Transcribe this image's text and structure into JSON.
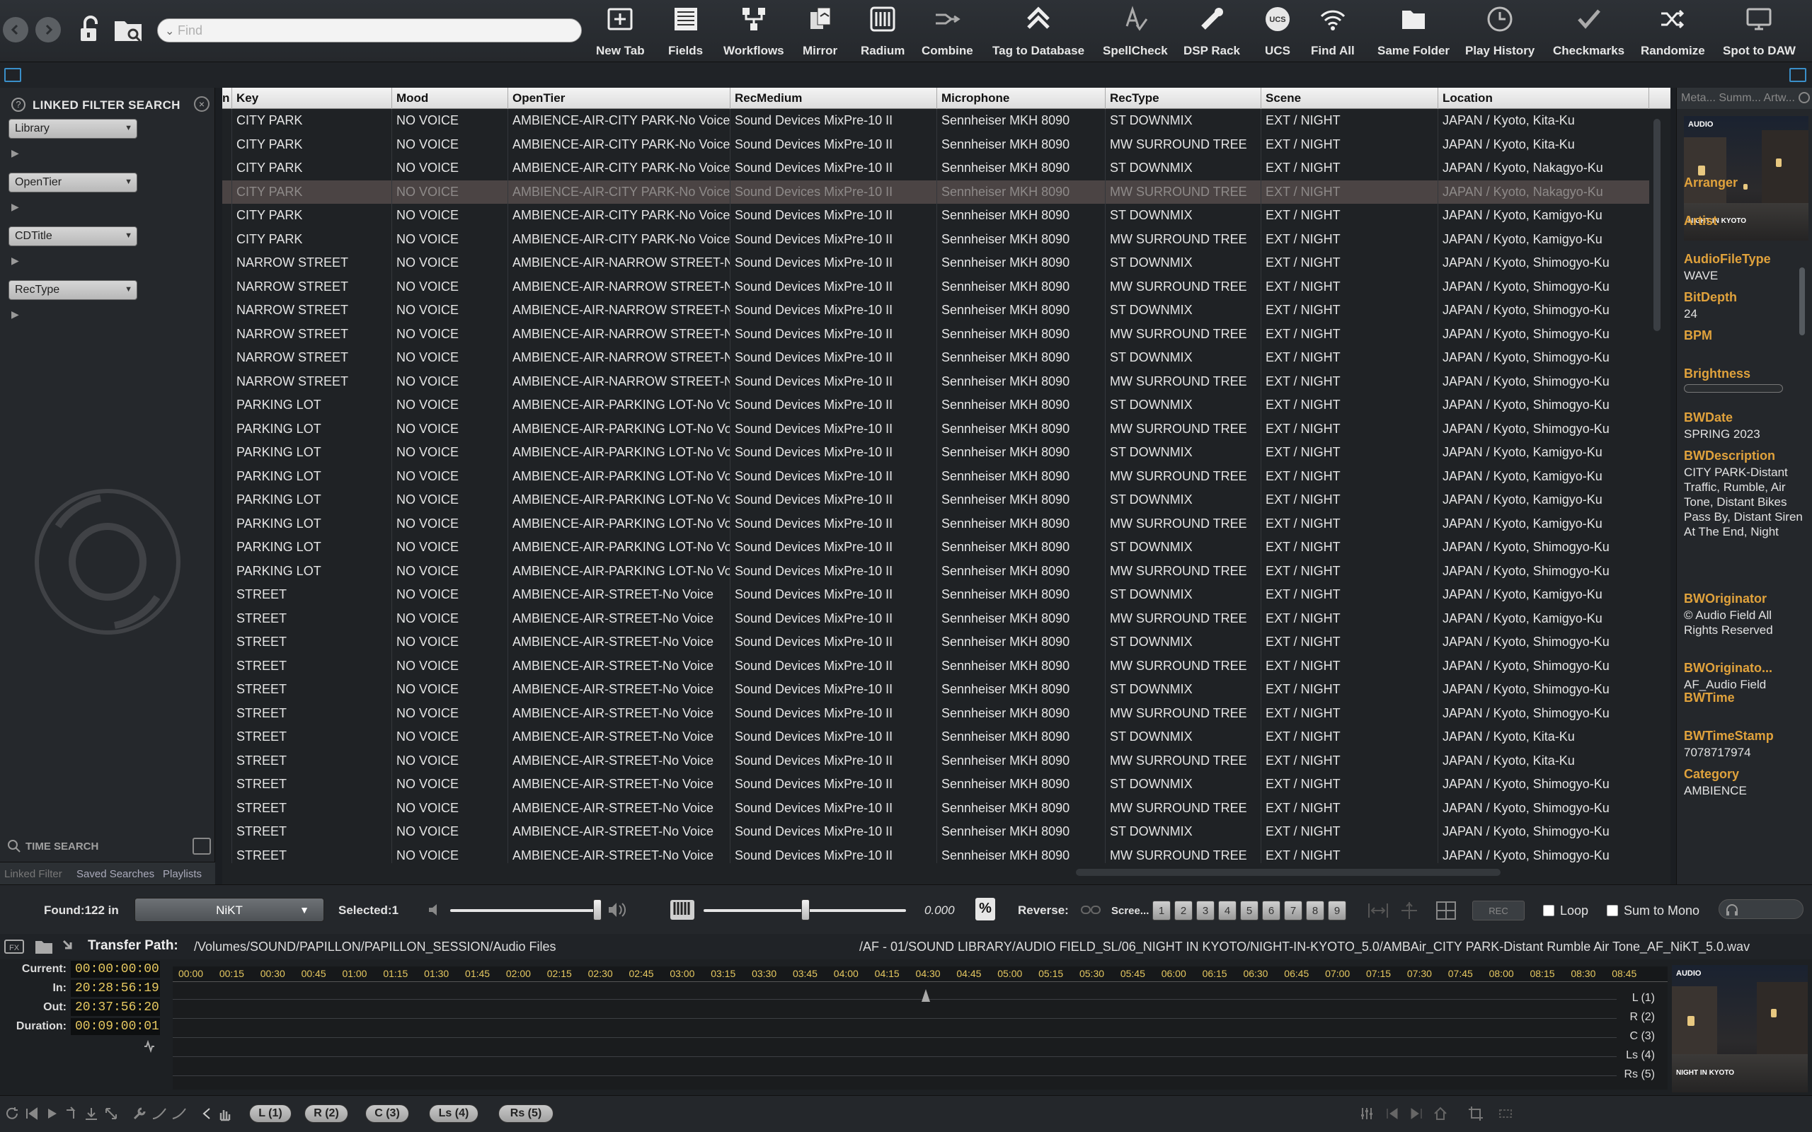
{
  "toolbar": {
    "find_placeholder": "Find",
    "tools": [
      {
        "label": "New Tab",
        "icon": "new-tab-icon"
      },
      {
        "label": "Fields",
        "icon": "fields-icon"
      },
      {
        "label": "Workflows",
        "icon": "workflows-icon"
      },
      {
        "label": "Mirror",
        "icon": "mirror-icon"
      },
      {
        "label": "Radium",
        "icon": "radium-icon"
      },
      {
        "label": "Combine",
        "icon": "combine-icon"
      },
      {
        "label": "Tag to Database",
        "icon": "tag-to-database-icon"
      },
      {
        "label": "SpellCheck",
        "icon": "spellcheck-icon"
      },
      {
        "label": "DSP Rack",
        "icon": "dsp-rack-icon"
      },
      {
        "label": "UCS",
        "icon": "ucs-icon"
      },
      {
        "label": "Find All",
        "icon": "find-all-icon"
      },
      {
        "label": "Same Folder",
        "icon": "same-folder-icon"
      },
      {
        "label": "Play History",
        "icon": "play-history-icon"
      },
      {
        "label": "Checkmarks",
        "icon": "checkmarks-icon"
      },
      {
        "label": "Randomize",
        "icon": "randomize-icon"
      },
      {
        "label": "Spot to DAW",
        "icon": "spot-to-daw-icon"
      }
    ]
  },
  "left_panel": {
    "title": "LINKED FILTER SEARCH",
    "filters": [
      "Library",
      "OpenTier",
      "CDTitle",
      "RecType"
    ],
    "time_search": "TIME SEARCH",
    "tabs": [
      "Linked Filter",
      "Saved Searches",
      "Playlists"
    ]
  },
  "table": {
    "columns": [
      "n",
      "Key",
      "Mood",
      "OpenTier",
      "RecMedium",
      "Microphone",
      "RecType",
      "Scene",
      "Location"
    ],
    "selected_row": 3,
    "rows": [
      [
        "CITY PARK",
        "NO VOICE",
        "AMBIENCE-AIR-CITY PARK-No Voice",
        "Sound Devices MixPre-10 II",
        "Sennheiser MKH 8090",
        "ST DOWNMIX",
        "EXT / NIGHT",
        "JAPAN / Kyoto, Kita-Ku"
      ],
      [
        "CITY PARK",
        "NO VOICE",
        "AMBIENCE-AIR-CITY PARK-No Voice",
        "Sound Devices MixPre-10 II",
        "Sennheiser MKH 8090",
        "MW SURROUND TREE",
        "EXT / NIGHT",
        "JAPAN / Kyoto, Kita-Ku"
      ],
      [
        "CITY PARK",
        "NO VOICE",
        "AMBIENCE-AIR-CITY PARK-No Voice",
        "Sound Devices MixPre-10 II",
        "Sennheiser MKH 8090",
        "ST DOWNMIX",
        "EXT / NIGHT",
        "JAPAN / Kyoto, Nakagyo-Ku"
      ],
      [
        "CITY PARK",
        "NO VOICE",
        "AMBIENCE-AIR-CITY PARK-No Voice",
        "Sound Devices MixPre-10 II",
        "Sennheiser MKH 8090",
        "MW SURROUND TREE",
        "EXT / NIGHT",
        "JAPAN / Kyoto, Nakagyo-Ku"
      ],
      [
        "CITY PARK",
        "NO VOICE",
        "AMBIENCE-AIR-CITY PARK-No Voice",
        "Sound Devices MixPre-10 II",
        "Sennheiser MKH 8090",
        "ST DOWNMIX",
        "EXT / NIGHT",
        "JAPAN / Kyoto, Kamigyo-Ku"
      ],
      [
        "CITY PARK",
        "NO VOICE",
        "AMBIENCE-AIR-CITY PARK-No Voice",
        "Sound Devices MixPre-10 II",
        "Sennheiser MKH 8090",
        "MW SURROUND TREE",
        "EXT / NIGHT",
        "JAPAN / Kyoto, Kamigyo-Ku"
      ],
      [
        "NARROW STREET",
        "NO VOICE",
        "AMBIENCE-AIR-NARROW STREET-No Voice",
        "Sound Devices MixPre-10 II",
        "Sennheiser MKH 8090",
        "ST DOWNMIX",
        "EXT / NIGHT",
        "JAPAN / Kyoto, Shimogyo-Ku"
      ],
      [
        "NARROW STREET",
        "NO VOICE",
        "AMBIENCE-AIR-NARROW STREET-No Voice",
        "Sound Devices MixPre-10 II",
        "Sennheiser MKH 8090",
        "MW SURROUND TREE",
        "EXT / NIGHT",
        "JAPAN / Kyoto, Shimogyo-Ku"
      ],
      [
        "NARROW STREET",
        "NO VOICE",
        "AMBIENCE-AIR-NARROW STREET-No Voice",
        "Sound Devices MixPre-10 II",
        "Sennheiser MKH 8090",
        "ST DOWNMIX",
        "EXT / NIGHT",
        "JAPAN / Kyoto, Shimogyo-Ku"
      ],
      [
        "NARROW STREET",
        "NO VOICE",
        "AMBIENCE-AIR-NARROW STREET-No Voice",
        "Sound Devices MixPre-10 II",
        "Sennheiser MKH 8090",
        "MW SURROUND TREE",
        "EXT / NIGHT",
        "JAPAN / Kyoto, Shimogyo-Ku"
      ],
      [
        "NARROW STREET",
        "NO VOICE",
        "AMBIENCE-AIR-NARROW STREET-No Voice",
        "Sound Devices MixPre-10 II",
        "Sennheiser MKH 8090",
        "ST DOWNMIX",
        "EXT / NIGHT",
        "JAPAN / Kyoto, Shimogyo-Ku"
      ],
      [
        "NARROW STREET",
        "NO VOICE",
        "AMBIENCE-AIR-NARROW STREET-No Voice",
        "Sound Devices MixPre-10 II",
        "Sennheiser MKH 8090",
        "MW SURROUND TREE",
        "EXT / NIGHT",
        "JAPAN / Kyoto, Shimogyo-Ku"
      ],
      [
        "PARKING LOT",
        "NO VOICE",
        "AMBIENCE-AIR-PARKING LOT-No Voice",
        "Sound Devices MixPre-10 II",
        "Sennheiser MKH 8090",
        "ST DOWNMIX",
        "EXT / NIGHT",
        "JAPAN / Kyoto, Shimogyo-Ku"
      ],
      [
        "PARKING LOT",
        "NO VOICE",
        "AMBIENCE-AIR-PARKING LOT-No Voice",
        "Sound Devices MixPre-10 II",
        "Sennheiser MKH 8090",
        "MW SURROUND TREE",
        "EXT / NIGHT",
        "JAPAN / Kyoto, Shimogyo-Ku"
      ],
      [
        "PARKING LOT",
        "NO VOICE",
        "AMBIENCE-AIR-PARKING LOT-No Voice",
        "Sound Devices MixPre-10 II",
        "Sennheiser MKH 8090",
        "ST DOWNMIX",
        "EXT / NIGHT",
        "JAPAN / Kyoto, Kamigyo-Ku"
      ],
      [
        "PARKING LOT",
        "NO VOICE",
        "AMBIENCE-AIR-PARKING LOT-No Voice",
        "Sound Devices MixPre-10 II",
        "Sennheiser MKH 8090",
        "MW SURROUND TREE",
        "EXT / NIGHT",
        "JAPAN / Kyoto, Kamigyo-Ku"
      ],
      [
        "PARKING LOT",
        "NO VOICE",
        "AMBIENCE-AIR-PARKING LOT-No Voice",
        "Sound Devices MixPre-10 II",
        "Sennheiser MKH 8090",
        "ST DOWNMIX",
        "EXT / NIGHT",
        "JAPAN / Kyoto, Kamigyo-Ku"
      ],
      [
        "PARKING LOT",
        "NO VOICE",
        "AMBIENCE-AIR-PARKING LOT-No Voice",
        "Sound Devices MixPre-10 II",
        "Sennheiser MKH 8090",
        "MW SURROUND TREE",
        "EXT / NIGHT",
        "JAPAN / Kyoto, Kamigyo-Ku"
      ],
      [
        "PARKING LOT",
        "NO VOICE",
        "AMBIENCE-AIR-PARKING LOT-No Voice",
        "Sound Devices MixPre-10 II",
        "Sennheiser MKH 8090",
        "ST DOWNMIX",
        "EXT / NIGHT",
        "JAPAN / Kyoto, Shimogyo-Ku"
      ],
      [
        "PARKING LOT",
        "NO VOICE",
        "AMBIENCE-AIR-PARKING LOT-No Voice",
        "Sound Devices MixPre-10 II",
        "Sennheiser MKH 8090",
        "MW SURROUND TREE",
        "EXT / NIGHT",
        "JAPAN / Kyoto, Shimogyo-Ku"
      ],
      [
        "STREET",
        "NO VOICE",
        "AMBIENCE-AIR-STREET-No Voice",
        "Sound Devices MixPre-10 II",
        "Sennheiser MKH 8090",
        "ST DOWNMIX",
        "EXT / NIGHT",
        "JAPAN / Kyoto, Kamigyo-Ku"
      ],
      [
        "STREET",
        "NO VOICE",
        "AMBIENCE-AIR-STREET-No Voice",
        "Sound Devices MixPre-10 II",
        "Sennheiser MKH 8090",
        "MW SURROUND TREE",
        "EXT / NIGHT",
        "JAPAN / Kyoto, Kamigyo-Ku"
      ],
      [
        "STREET",
        "NO VOICE",
        "AMBIENCE-AIR-STREET-No Voice",
        "Sound Devices MixPre-10 II",
        "Sennheiser MKH 8090",
        "ST DOWNMIX",
        "EXT / NIGHT",
        "JAPAN / Kyoto, Shimogyo-Ku"
      ],
      [
        "STREET",
        "NO VOICE",
        "AMBIENCE-AIR-STREET-No Voice",
        "Sound Devices MixPre-10 II",
        "Sennheiser MKH 8090",
        "MW SURROUND TREE",
        "EXT / NIGHT",
        "JAPAN / Kyoto, Shimogyo-Ku"
      ],
      [
        "STREET",
        "NO VOICE",
        "AMBIENCE-AIR-STREET-No Voice",
        "Sound Devices MixPre-10 II",
        "Sennheiser MKH 8090",
        "ST DOWNMIX",
        "EXT / NIGHT",
        "JAPAN / Kyoto, Shimogyo-Ku"
      ],
      [
        "STREET",
        "NO VOICE",
        "AMBIENCE-AIR-STREET-No Voice",
        "Sound Devices MixPre-10 II",
        "Sennheiser MKH 8090",
        "MW SURROUND TREE",
        "EXT / NIGHT",
        "JAPAN / Kyoto, Shimogyo-Ku"
      ],
      [
        "STREET",
        "NO VOICE",
        "AMBIENCE-AIR-STREET-No Voice",
        "Sound Devices MixPre-10 II",
        "Sennheiser MKH 8090",
        "ST DOWNMIX",
        "EXT / NIGHT",
        "JAPAN / Kyoto, Kita-Ku"
      ],
      [
        "STREET",
        "NO VOICE",
        "AMBIENCE-AIR-STREET-No Voice",
        "Sound Devices MixPre-10 II",
        "Sennheiser MKH 8090",
        "MW SURROUND TREE",
        "EXT / NIGHT",
        "JAPAN / Kyoto, Kita-Ku"
      ],
      [
        "STREET",
        "NO VOICE",
        "AMBIENCE-AIR-STREET-No Voice",
        "Sound Devices MixPre-10 II",
        "Sennheiser MKH 8090",
        "ST DOWNMIX",
        "EXT / NIGHT",
        "JAPAN / Kyoto, Shimogyo-Ku"
      ],
      [
        "STREET",
        "NO VOICE",
        "AMBIENCE-AIR-STREET-No Voice",
        "Sound Devices MixPre-10 II",
        "Sennheiser MKH 8090",
        "MW SURROUND TREE",
        "EXT / NIGHT",
        "JAPAN / Kyoto, Shimogyo-Ku"
      ],
      [
        "STREET",
        "NO VOICE",
        "AMBIENCE-AIR-STREET-No Voice",
        "Sound Devices MixPre-10 II",
        "Sennheiser MKH 8090",
        "ST DOWNMIX",
        "EXT / NIGHT",
        "JAPAN / Kyoto, Shimogyo-Ku"
      ],
      [
        "STREET",
        "NO VOICE",
        "AMBIENCE-AIR-STREET-No Voice",
        "Sound Devices MixPre-10 II",
        "Sennheiser MKH 8090",
        "MW SURROUND TREE",
        "EXT / NIGHT",
        "JAPAN / Kyoto, Shimogyo-Ku"
      ]
    ]
  },
  "meta_panel": {
    "tabs": "Meta... Summ... Artw...",
    "artwork_logo": "AUDIO",
    "artwork_caption": "NIGHT IN KYOTO",
    "fields": [
      {
        "key": "Arranger",
        "value": ""
      },
      {
        "key": "Artist",
        "value": ""
      },
      {
        "key": "AudioFileType",
        "value": "WAVE"
      },
      {
        "key": "BitDepth",
        "value": "24"
      },
      {
        "key": "BPM",
        "value": ""
      },
      {
        "key": "Brightness",
        "value": ""
      },
      {
        "key": "BWDate",
        "value": "SPRING 2023"
      },
      {
        "key": "BWDescription",
        "value": "CITY PARK-Distant Traffic, Rumble, Air Tone, Distant Bikes Pass By, Distant Siren At The End, Night"
      },
      {
        "key": "BWOriginator",
        "value": "© Audio Field All Rights Reserved"
      },
      {
        "key": "BWOriginato...",
        "value": "AF_Audio Field"
      },
      {
        "key": "BWTime",
        "value": ""
      },
      {
        "key": "BWTimeStamp",
        "value": "7078717974"
      },
      {
        "key": "Category",
        "value": "AMBIENCE"
      }
    ]
  },
  "transport": {
    "found": "Found:122 in",
    "user": "NiKT",
    "selected": "Selected:1",
    "pitch_value": "0.000",
    "percent_label": "%",
    "reverse_label": "Reverse:",
    "screen_label": "Scree...",
    "screens": [
      "1",
      "2",
      "3",
      "4",
      "5",
      "6",
      "7",
      "8",
      "9"
    ],
    "rec_label": "REC",
    "loop_label": "Loop",
    "sum_to_mono_label": "Sum to Mono"
  },
  "transfer": {
    "label": "Transfer Path:",
    "path": "/Volumes/SOUND/PAPILLON/PAPILLON_SESSION/Audio Files",
    "file": "/AF - 01/SOUND LIBRARY/AUDIO FIELD_SL/06_NIGHT IN KYOTO/NIGHT-IN-KYOTO_5.0/AMBAir_CITY PARK-Distant Rumble Air Tone_AF_NiKT_5.0.wav"
  },
  "timeline": {
    "current_label": "Current:",
    "current": "00:00:00:00",
    "in_label": "In:",
    "in": "20:28:56:19",
    "out_label": "Out:",
    "out": "20:37:56:20",
    "duration_label": "Duration:",
    "duration": "00:09:00:01",
    "ticks": [
      "00:00",
      "00:15",
      "00:30",
      "00:45",
      "01:00",
      "01:15",
      "01:30",
      "01:45",
      "02:00",
      "02:15",
      "02:30",
      "02:45",
      "03:00",
      "03:15",
      "03:30",
      "03:45",
      "04:00",
      "04:15",
      "04:30",
      "04:45",
      "05:00",
      "05:15",
      "05:30",
      "05:45",
      "06:00",
      "06:15",
      "06:30",
      "06:45",
      "07:00",
      "07:15",
      "07:30",
      "07:45",
      "08:00",
      "08:15",
      "08:30",
      "08:45"
    ],
    "lanes": [
      "L (1)",
      "R (2)",
      "C (3)",
      "Ls (4)",
      "Rs (5)"
    ]
  },
  "bottom": {
    "channels": [
      "L (1)",
      "R (2)",
      "C (3)",
      "Ls (4)",
      "Rs (5)"
    ]
  }
}
